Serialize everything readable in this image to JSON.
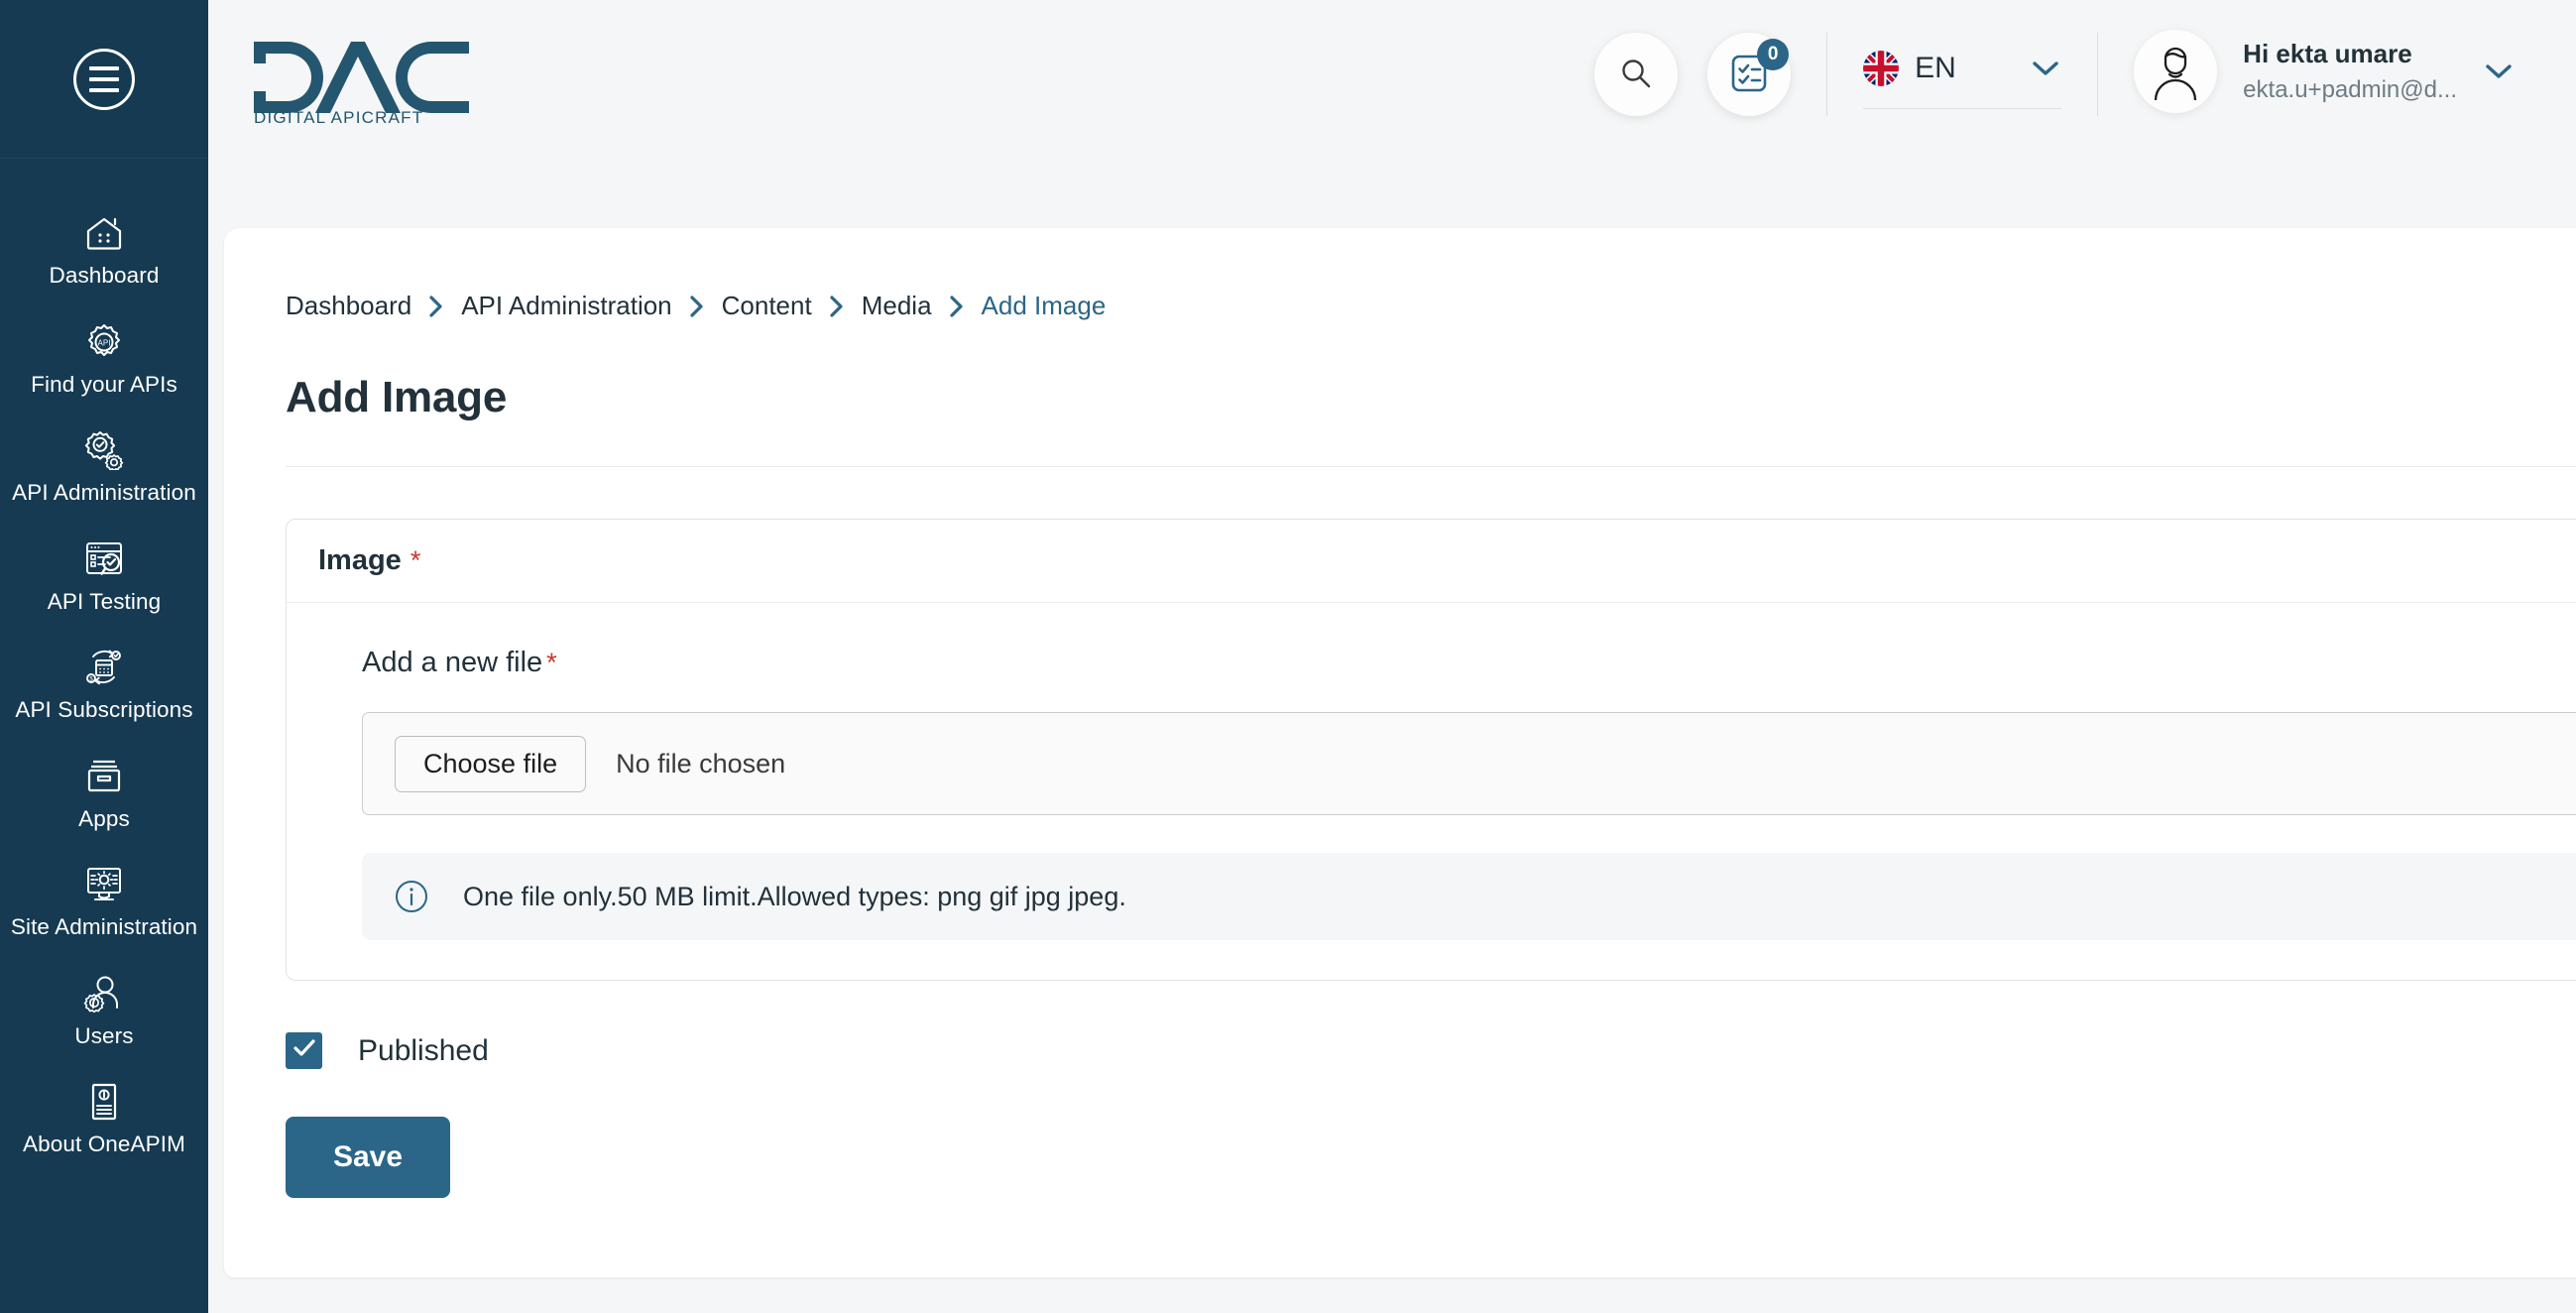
{
  "sidebar": {
    "menu_toggle_label": "Menu",
    "items": [
      {
        "label": "Dashboard",
        "icon": "dashboard-home-icon"
      },
      {
        "label": "Find your APIs",
        "icon": "api-gear-search-icon"
      },
      {
        "label": "API Administration",
        "icon": "api-admin-gears-icon"
      },
      {
        "label": "API Testing",
        "icon": "api-testing-checklist-icon"
      },
      {
        "label": "API Subscriptions",
        "icon": "api-subscriptions-calendar-icon"
      },
      {
        "label": "Apps",
        "icon": "apps-archive-box-icon"
      },
      {
        "label": "Site Administration",
        "icon": "site-admin-monitor-icon"
      },
      {
        "label": "Users",
        "icon": "users-person-gear-icon"
      },
      {
        "label": "About OneAPIM",
        "icon": "about-document-info-icon"
      }
    ]
  },
  "header": {
    "logo_title": "DAC",
    "logo_subtitle": "DIGITAL APICRAFT",
    "search_icon": "search-icon",
    "tasks_icon": "tasks-checklist-icon",
    "tasks_badge_count": "0",
    "language": {
      "flag_icon": "uk-flag-icon",
      "code": "EN",
      "chevron_icon": "chevron-down-icon"
    },
    "user": {
      "avatar_icon": "user-avatar-icon",
      "greeting": "Hi ekta umare",
      "email": "ekta.u+padmin@d...",
      "chevron_icon": "chevron-down-icon"
    }
  },
  "breadcrumb": {
    "items": [
      {
        "label": "Dashboard",
        "current": false
      },
      {
        "label": "API Administration",
        "current": false
      },
      {
        "label": "Content",
        "current": false
      },
      {
        "label": "Media",
        "current": false
      },
      {
        "label": "Add Image",
        "current": true
      }
    ],
    "separator_icon": "chevron-right-icon"
  },
  "page": {
    "title": "Add Image"
  },
  "image_panel": {
    "title": "Image",
    "required_mark": "*",
    "collapse_icon": "chevron-up-icon",
    "field_label": "Add a new file",
    "field_required_mark": "*",
    "choose_file_label": "Choose file",
    "file_status": "No file chosen",
    "info_icon": "info-circle-icon",
    "info_text": "One file only.50 MB limit.Allowed types: png gif jpg jpeg."
  },
  "form": {
    "published_label": "Published",
    "published_checked": true,
    "check_icon": "check-icon",
    "save_label": "Save"
  },
  "colors": {
    "sidebar_bg": "#153a52",
    "accent": "#2b6689",
    "page_bg": "#f5f6f7",
    "required_red": "#d0342c",
    "text_primary": "#22313a"
  }
}
